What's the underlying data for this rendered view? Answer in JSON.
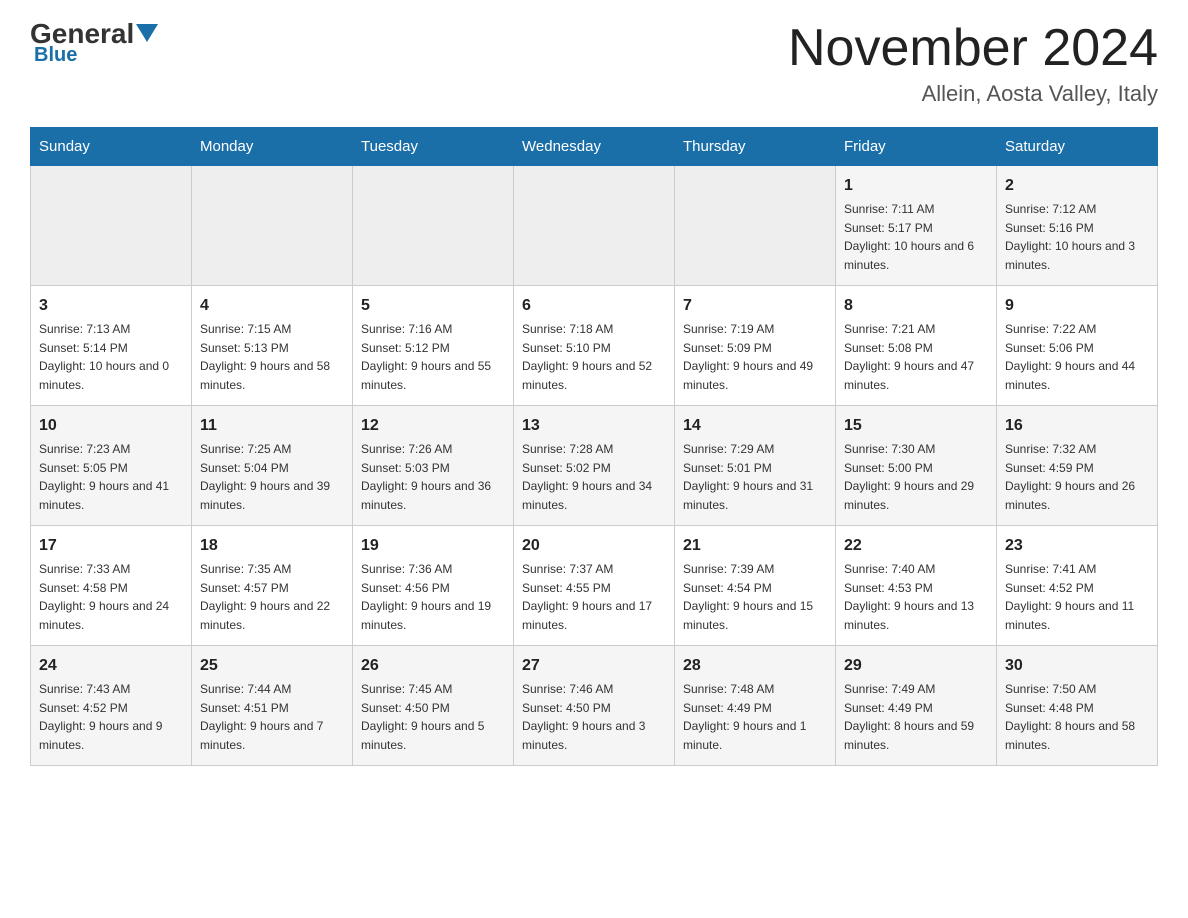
{
  "header": {
    "logo_general": "General",
    "logo_blue": "Blue",
    "month_title": "November 2024",
    "location": "Allein, Aosta Valley, Italy"
  },
  "days_of_week": [
    "Sunday",
    "Monday",
    "Tuesday",
    "Wednesday",
    "Thursday",
    "Friday",
    "Saturday"
  ],
  "weeks": [
    [
      {
        "day": "",
        "info": ""
      },
      {
        "day": "",
        "info": ""
      },
      {
        "day": "",
        "info": ""
      },
      {
        "day": "",
        "info": ""
      },
      {
        "day": "",
        "info": ""
      },
      {
        "day": "1",
        "info": "Sunrise: 7:11 AM\nSunset: 5:17 PM\nDaylight: 10 hours and 6 minutes."
      },
      {
        "day": "2",
        "info": "Sunrise: 7:12 AM\nSunset: 5:16 PM\nDaylight: 10 hours and 3 minutes."
      }
    ],
    [
      {
        "day": "3",
        "info": "Sunrise: 7:13 AM\nSunset: 5:14 PM\nDaylight: 10 hours and 0 minutes."
      },
      {
        "day": "4",
        "info": "Sunrise: 7:15 AM\nSunset: 5:13 PM\nDaylight: 9 hours and 58 minutes."
      },
      {
        "day": "5",
        "info": "Sunrise: 7:16 AM\nSunset: 5:12 PM\nDaylight: 9 hours and 55 minutes."
      },
      {
        "day": "6",
        "info": "Sunrise: 7:18 AM\nSunset: 5:10 PM\nDaylight: 9 hours and 52 minutes."
      },
      {
        "day": "7",
        "info": "Sunrise: 7:19 AM\nSunset: 5:09 PM\nDaylight: 9 hours and 49 minutes."
      },
      {
        "day": "8",
        "info": "Sunrise: 7:21 AM\nSunset: 5:08 PM\nDaylight: 9 hours and 47 minutes."
      },
      {
        "day": "9",
        "info": "Sunrise: 7:22 AM\nSunset: 5:06 PM\nDaylight: 9 hours and 44 minutes."
      }
    ],
    [
      {
        "day": "10",
        "info": "Sunrise: 7:23 AM\nSunset: 5:05 PM\nDaylight: 9 hours and 41 minutes."
      },
      {
        "day": "11",
        "info": "Sunrise: 7:25 AM\nSunset: 5:04 PM\nDaylight: 9 hours and 39 minutes."
      },
      {
        "day": "12",
        "info": "Sunrise: 7:26 AM\nSunset: 5:03 PM\nDaylight: 9 hours and 36 minutes."
      },
      {
        "day": "13",
        "info": "Sunrise: 7:28 AM\nSunset: 5:02 PM\nDaylight: 9 hours and 34 minutes."
      },
      {
        "day": "14",
        "info": "Sunrise: 7:29 AM\nSunset: 5:01 PM\nDaylight: 9 hours and 31 minutes."
      },
      {
        "day": "15",
        "info": "Sunrise: 7:30 AM\nSunset: 5:00 PM\nDaylight: 9 hours and 29 minutes."
      },
      {
        "day": "16",
        "info": "Sunrise: 7:32 AM\nSunset: 4:59 PM\nDaylight: 9 hours and 26 minutes."
      }
    ],
    [
      {
        "day": "17",
        "info": "Sunrise: 7:33 AM\nSunset: 4:58 PM\nDaylight: 9 hours and 24 minutes."
      },
      {
        "day": "18",
        "info": "Sunrise: 7:35 AM\nSunset: 4:57 PM\nDaylight: 9 hours and 22 minutes."
      },
      {
        "day": "19",
        "info": "Sunrise: 7:36 AM\nSunset: 4:56 PM\nDaylight: 9 hours and 19 minutes."
      },
      {
        "day": "20",
        "info": "Sunrise: 7:37 AM\nSunset: 4:55 PM\nDaylight: 9 hours and 17 minutes."
      },
      {
        "day": "21",
        "info": "Sunrise: 7:39 AM\nSunset: 4:54 PM\nDaylight: 9 hours and 15 minutes."
      },
      {
        "day": "22",
        "info": "Sunrise: 7:40 AM\nSunset: 4:53 PM\nDaylight: 9 hours and 13 minutes."
      },
      {
        "day": "23",
        "info": "Sunrise: 7:41 AM\nSunset: 4:52 PM\nDaylight: 9 hours and 11 minutes."
      }
    ],
    [
      {
        "day": "24",
        "info": "Sunrise: 7:43 AM\nSunset: 4:52 PM\nDaylight: 9 hours and 9 minutes."
      },
      {
        "day": "25",
        "info": "Sunrise: 7:44 AM\nSunset: 4:51 PM\nDaylight: 9 hours and 7 minutes."
      },
      {
        "day": "26",
        "info": "Sunrise: 7:45 AM\nSunset: 4:50 PM\nDaylight: 9 hours and 5 minutes."
      },
      {
        "day": "27",
        "info": "Sunrise: 7:46 AM\nSunset: 4:50 PM\nDaylight: 9 hours and 3 minutes."
      },
      {
        "day": "28",
        "info": "Sunrise: 7:48 AM\nSunset: 4:49 PM\nDaylight: 9 hours and 1 minute."
      },
      {
        "day": "29",
        "info": "Sunrise: 7:49 AM\nSunset: 4:49 PM\nDaylight: 8 hours and 59 minutes."
      },
      {
        "day": "30",
        "info": "Sunrise: 7:50 AM\nSunset: 4:48 PM\nDaylight: 8 hours and 58 minutes."
      }
    ]
  ]
}
